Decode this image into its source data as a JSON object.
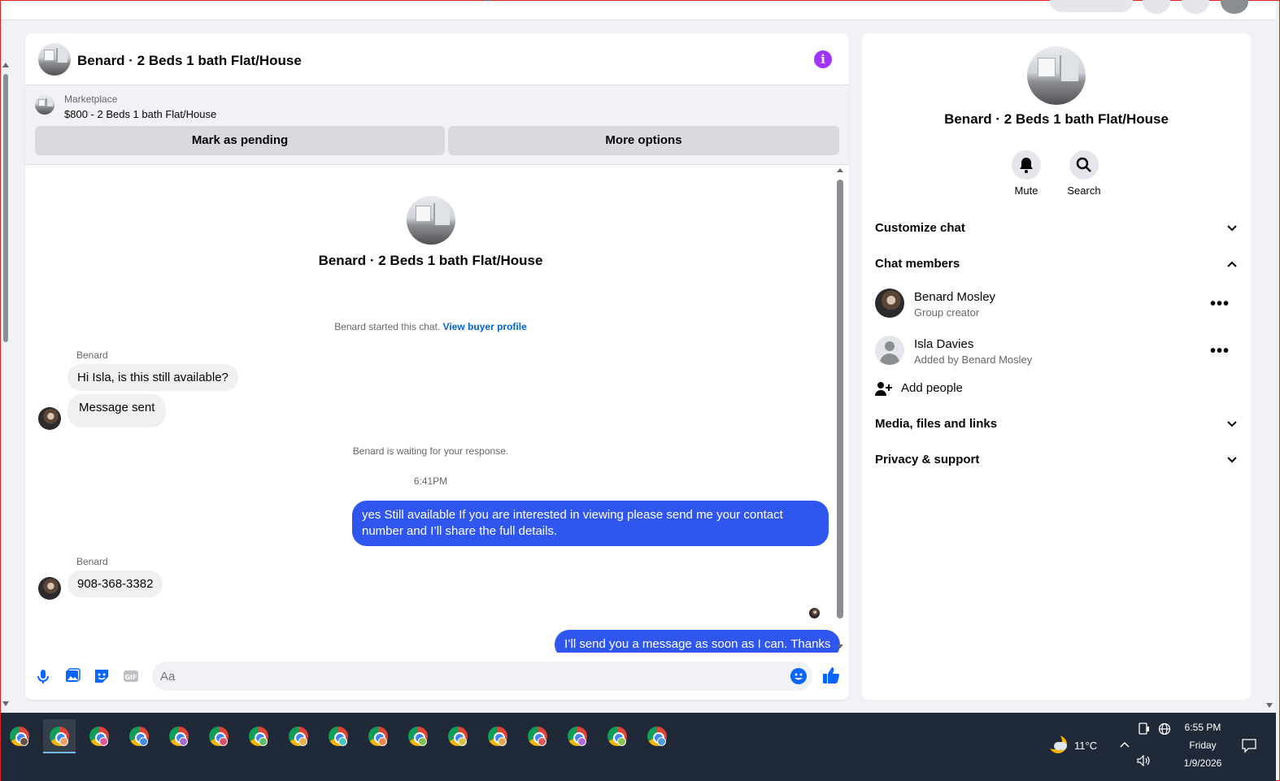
{
  "chat": {
    "title": "Benard · 2 Beds 1 bath Flat/House",
    "marketplace": {
      "label": "Marketplace",
      "listing": "$800 - 2 Beds 1 bath Flat/House",
      "pending_button": "Mark as pending",
      "options_button": "More options"
    },
    "intro_name": "Benard · 2 Beds 1 bath Flat/House",
    "started_text": "Benard started this chat.",
    "buyer_profile_link": "View buyer profile",
    "sender_name_1": "Benard",
    "msg_1": "Hi Isla, is this still available?",
    "msg_2": "Message sent",
    "waiting_text": "Benard is waiting for your response.",
    "timestamp": "6:41PM",
    "reply_1": "yes Still available If you are interested in viewing please send me your contact number and I’ll share the full details.",
    "sender_name_2": "Benard",
    "msg_3": "908-368-3382",
    "reply_2": "I’ll send you a message as soon as I can. Thanks",
    "composer_placeholder": "Aa"
  },
  "info_panel": {
    "name": "Benard · 2 Beds 1 bath Flat/House",
    "mute_label": "Mute",
    "search_label": "Search",
    "customize_chat": "Customize chat",
    "chat_members": "Chat members",
    "members": [
      {
        "name": "Benard Mosley",
        "role": "Group creator"
      },
      {
        "name": "Isla Davies",
        "role": "Added by Benard Mosley"
      }
    ],
    "add_people": "Add people",
    "media_files_links": "Media, files and links",
    "privacy_support": "Privacy & support"
  },
  "taskbar": {
    "temperature": "11°C",
    "time": "6:55 PM",
    "day": "Friday",
    "date": "1/9/2026"
  },
  "colors": {
    "accent_blue": "#2f57ef",
    "link_blue": "#0064d1",
    "info_purple": "#a033ff",
    "taskbar_bg": "#1f2937"
  }
}
